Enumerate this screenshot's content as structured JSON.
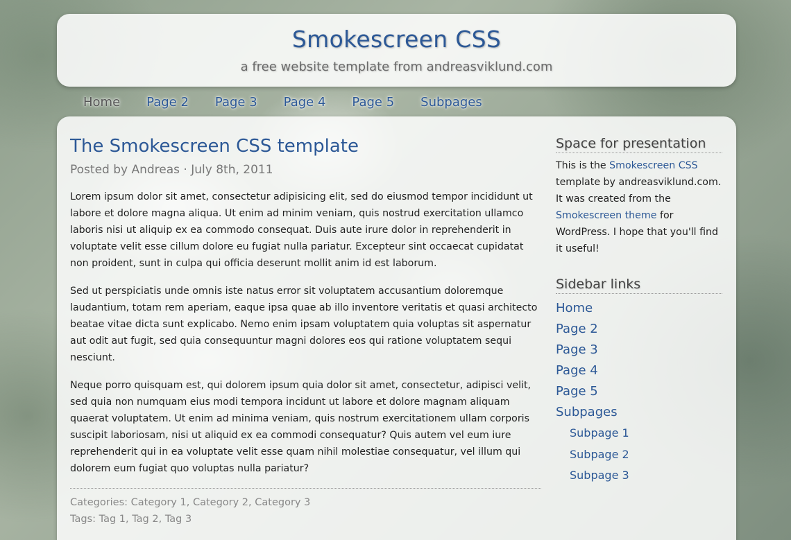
{
  "header": {
    "title": "Smokescreen CSS",
    "tagline": "a free website template from andreasviklund.com"
  },
  "nav": {
    "items": [
      "Home",
      "Page 2",
      "Page 3",
      "Page 4",
      "Page 5",
      "Subpages"
    ]
  },
  "post": {
    "title": "The Smokescreen CSS template",
    "meta": "Posted by Andreas · July 8th, 2011",
    "paragraphs": [
      "Lorem ipsum dolor sit amet, consectetur adipisicing elit, sed do eiusmod tempor incididunt ut labore et dolore magna aliqua. Ut enim ad minim veniam, quis nostrud exercitation ullamco laboris nisi ut aliquip ex ea commodo consequat. Duis aute irure dolor in reprehenderit in voluptate velit esse cillum dolore eu fugiat nulla pariatur. Excepteur sint occaecat cupidatat non proident, sunt in culpa qui officia deserunt mollit anim id est laborum.",
      "Sed ut perspiciatis unde omnis iste natus error sit voluptatem accusantium doloremque laudantium, totam rem aperiam, eaque ipsa quae ab illo inventore veritatis et quasi architecto beatae vitae dicta sunt explicabo. Nemo enim ipsam voluptatem quia voluptas sit aspernatur aut odit aut fugit, sed quia consequuntur magni dolores eos qui ratione voluptatem sequi nesciunt.",
      "Neque porro quisquam est, qui dolorem ipsum quia dolor sit amet, consectetur, adipisci velit, sed quia non numquam eius modi tempora incidunt ut labore et dolore magnam aliquam quaerat voluptatem. Ut enim ad minima veniam, quis nostrum exercitationem ullam corporis suscipit laboriosam, nisi ut aliquid ex ea commodi consequatur? Quis autem vel eum iure reprehenderit qui in ea voluptate velit esse quam nihil molestiae consequatur, vel illum qui dolorem eum fugiat quo voluptas nulla pariatur?"
    ],
    "categories_label": "Categories:",
    "categories": [
      "Category 1",
      "Category 2",
      "Category 3"
    ],
    "tags_label": "Tags:",
    "tags": [
      "Tag 1",
      "Tag 2",
      "Tag 3"
    ]
  },
  "sidebar": {
    "presentation": {
      "heading": "Space for presentation",
      "text_1": "This is the ",
      "link_1": "Smokescreen CSS",
      "text_2": " template by andreasviklund.com. It was created from the ",
      "link_2": "Smokescreen theme",
      "text_3": " for WordPress. I hope that you'll find it useful!"
    },
    "links": {
      "heading": "Sidebar links",
      "items": [
        "Home",
        "Page 2",
        "Page 3",
        "Page 4",
        "Page 5",
        "Subpages"
      ],
      "subitems": [
        "Subpage 1",
        "Subpage 2",
        "Subpage 3"
      ]
    }
  },
  "colors": {
    "link": "#2c5896",
    "meta": "#777777",
    "current_nav": "#555555"
  }
}
